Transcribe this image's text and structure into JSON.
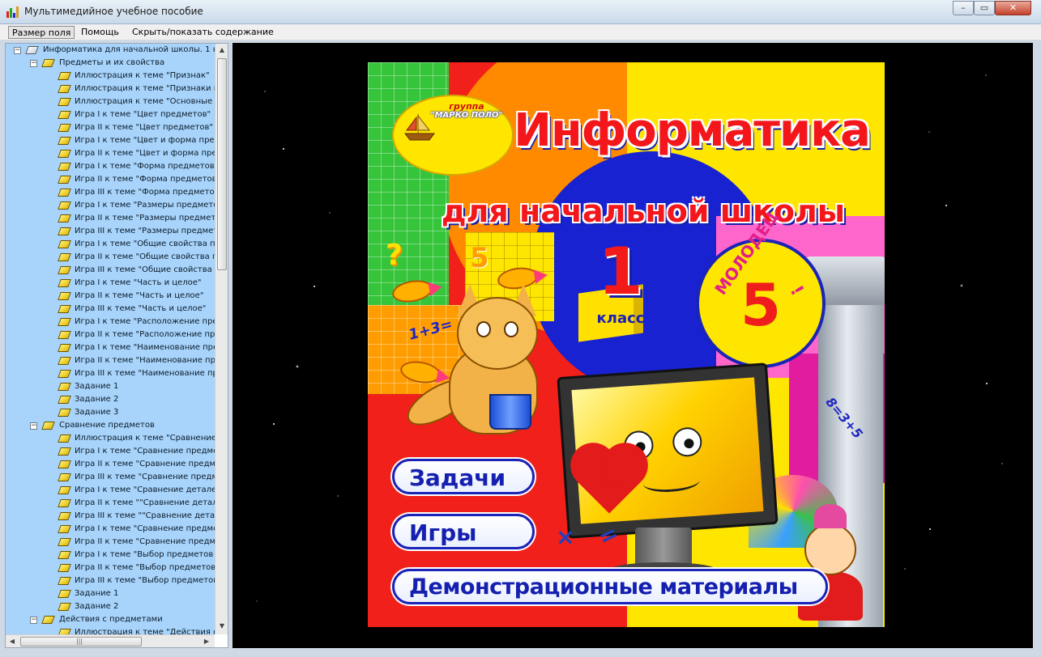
{
  "window": {
    "title": "Мультимедийное учебное пособие",
    "buttons": {
      "minimize": "–",
      "maximize": "▭",
      "close": "✕"
    }
  },
  "menu": {
    "items": [
      "Размер поля",
      "Помощь",
      "Скрыть/показать содержание"
    ]
  },
  "tree": {
    "root": "Информатика для начальной школы. 1 кл",
    "rows": [
      "Предметы и их свойства",
      "Иллюстрация к теме \"Признак\"",
      "Иллюстрация к теме \"Признаки п",
      "Иллюстрация к теме \"Основные п",
      "Игра I к теме \"Цвет предметов\"",
      "Игра II к теме \"Цвет предметов\"",
      "Игра I к теме \"Цвет и форма пред",
      "Игра II к теме \"Цвет и форма пред",
      "Игра I к теме \"Форма предметов",
      "Игра II к теме \"Форма предметов",
      "Игра III к теме \"Форма предмето",
      "Игра I к теме \"Размеры предмето",
      "Игра II к теме \"Размеры предмет",
      "Игра III к теме \"Размеры предмет",
      "Игра I к теме \"Общие свойства пр",
      "Игра II к теме \"Общие свойства п",
      "Игра III к теме \"Общие свойства п",
      "Игра I к теме \"Часть и целое\"",
      "Игра II к теме \"Часть и целое\"",
      "Игра III к теме \"Часть и целое\"",
      "Игра I к теме \"Расположение пре",
      "Игра II к теме \"Расположение пре",
      "Игра I к теме \"Наименование пре",
      "Игра II к теме \"Наименование пре",
      "Игра III к теме \"Наименование пр",
      "Задание 1",
      "Задание 2",
      "Задание 3",
      "Сравнение предметов",
      "Иллюстрация к теме \"Сравнение",
      "Игра I к теме \"Сравнение предме",
      "Игра II к теме \"Сравнение предме",
      "Игра III к теме \"Сравнение предм",
      "Игра I к теме \"Сравнение деталей",
      "Игра II к теме \"\"Сравнение детал",
      "Игра III к теме \"\"Сравнение детал",
      "Игра I к теме \"Сравнение предме",
      "Игра II к теме \"Сравнение предме",
      "Игра I к теме \"Выбор предметов п",
      "Игра II к теме \"Выбор предметов",
      "Игра III к теме \"Выбор предметов",
      "Задание 1",
      "Задание 2",
      "Действия с предметами",
      "Иллюстрация к теме \"Действия с"
    ]
  },
  "cover": {
    "logo_line1": "группа",
    "logo_line2": "\"МАРКО ПОЛО\"",
    "title": "Информатика",
    "subtitle": "для начальной школы",
    "grade_number": "1",
    "grade_word": "класс",
    "badge_word": "МОЛОДЕЦ",
    "badge_number": "5",
    "badge_exclaim": "!",
    "formula_left": "1+3=",
    "formula_right": "8=3+5",
    "qmark": "?",
    "five_small": "5",
    "sym_times": "×",
    "sym_equals": "=",
    "buttons": [
      "Задачи",
      "Игры",
      "Демонстрационные материалы"
    ]
  },
  "colors": {
    "title_red": "#f3161b",
    "button_blue": "#1520b0",
    "tree_bg": "#a8d4fb"
  }
}
